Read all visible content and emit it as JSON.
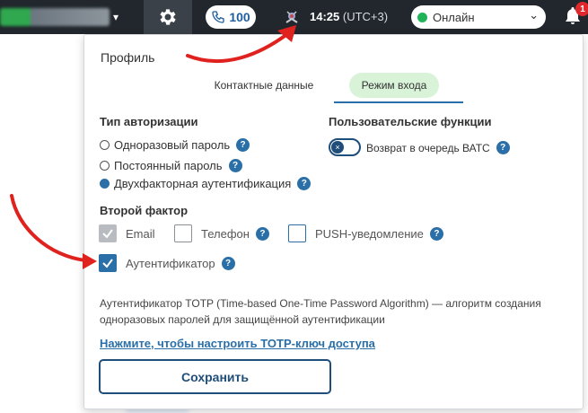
{
  "topbar": {
    "calls_count": "100",
    "time": "14:25",
    "timezone": "(UTC+3)",
    "status": "Онлайн",
    "notifications_badge": "1",
    "icons": [
      "gear-icon",
      "phone-icon",
      "extension-icon",
      "bell-icon",
      "chevron-down-icon"
    ],
    "colors": {
      "bar": "#21272d",
      "online": "#20b35a",
      "badge": "#e0272b"
    }
  },
  "panel": {
    "title": "Профиль",
    "tabs": [
      {
        "label": "Контактные данные",
        "active": false
      },
      {
        "label": "Режим входа",
        "active": true
      }
    ],
    "auth": {
      "heading": "Тип авторизации",
      "options": [
        {
          "label": "Одноразовый пароль",
          "selected": false
        },
        {
          "label": "Постоянный пароль",
          "selected": false
        },
        {
          "label": "Двухфакторная аутентификация",
          "selected": true
        }
      ]
    },
    "user_functions": {
      "heading": "Пользовательские функции",
      "toggle_label": "Возврат в очередь ВАТС",
      "toggle_on": false
    },
    "second_factor": {
      "heading": "Второй фактор",
      "options": [
        {
          "label": "Email",
          "checked": true,
          "disabled": true
        },
        {
          "label": "Телефон",
          "checked": false
        },
        {
          "label": "PUSH-уведомление",
          "checked": false
        },
        {
          "label": "Аутентификатор",
          "checked": true
        }
      ]
    },
    "description": "Аутентификатор TOTP (Time-based One-Time Password Algorithm) — алгоритм создания одноразовых паролей для защищённой аутентификации",
    "setup_link": "Нажмите, чтобы настроить TOTP-ключ доступа",
    "save_label": "Сохранить",
    "help_mark": "?",
    "accent": "#2a6fa8"
  }
}
